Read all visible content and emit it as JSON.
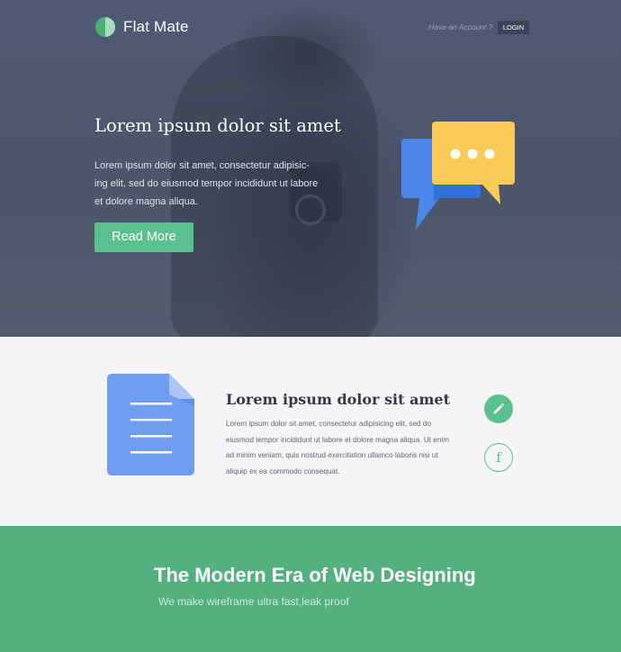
{
  "header": {
    "brand": "Flat Mate",
    "account_prompt": "Have an Account ?",
    "login_label": "LOGIN"
  },
  "hero": {
    "title": "Lorem ipsum dolor sit amet",
    "body": "Lorem ipsum dolor sit amet, consectetur adipisic-ing elit, sed do eiusmod tempor incididunt ut labore et dolore magna aliqua.",
    "button_label": "Read More",
    "icon": "chat-bubbles-icon"
  },
  "feature": {
    "icon": "document-icon",
    "title": "Lorem ipsum dolor sit amet",
    "body": "Lorem ipsum dolor sit amet, consectetur adipisicing elit, sed do eiusmod tempor incididunt ut labore et dolore magna aliqua. Ut enim ad minim veniam, quis nostrud exercitation ullamco laboris nisi ut aliquip ex ea commodo consequat.",
    "actions": [
      "pencil-icon",
      "facebook-icon"
    ],
    "facebook_glyph": "f"
  },
  "banner": {
    "title": "The Modern Era of Web Designing",
    "subtitle": "We make wireframe ultra fast,leak proof"
  },
  "colors": {
    "accent_green": "#5ac18e",
    "banner_green": "#54b07f",
    "hero_overlay": "#4b566c",
    "chat_blue": "#4b86ea",
    "chat_yellow": "#f7cb55",
    "doc_blue": "#6d9ef1"
  }
}
